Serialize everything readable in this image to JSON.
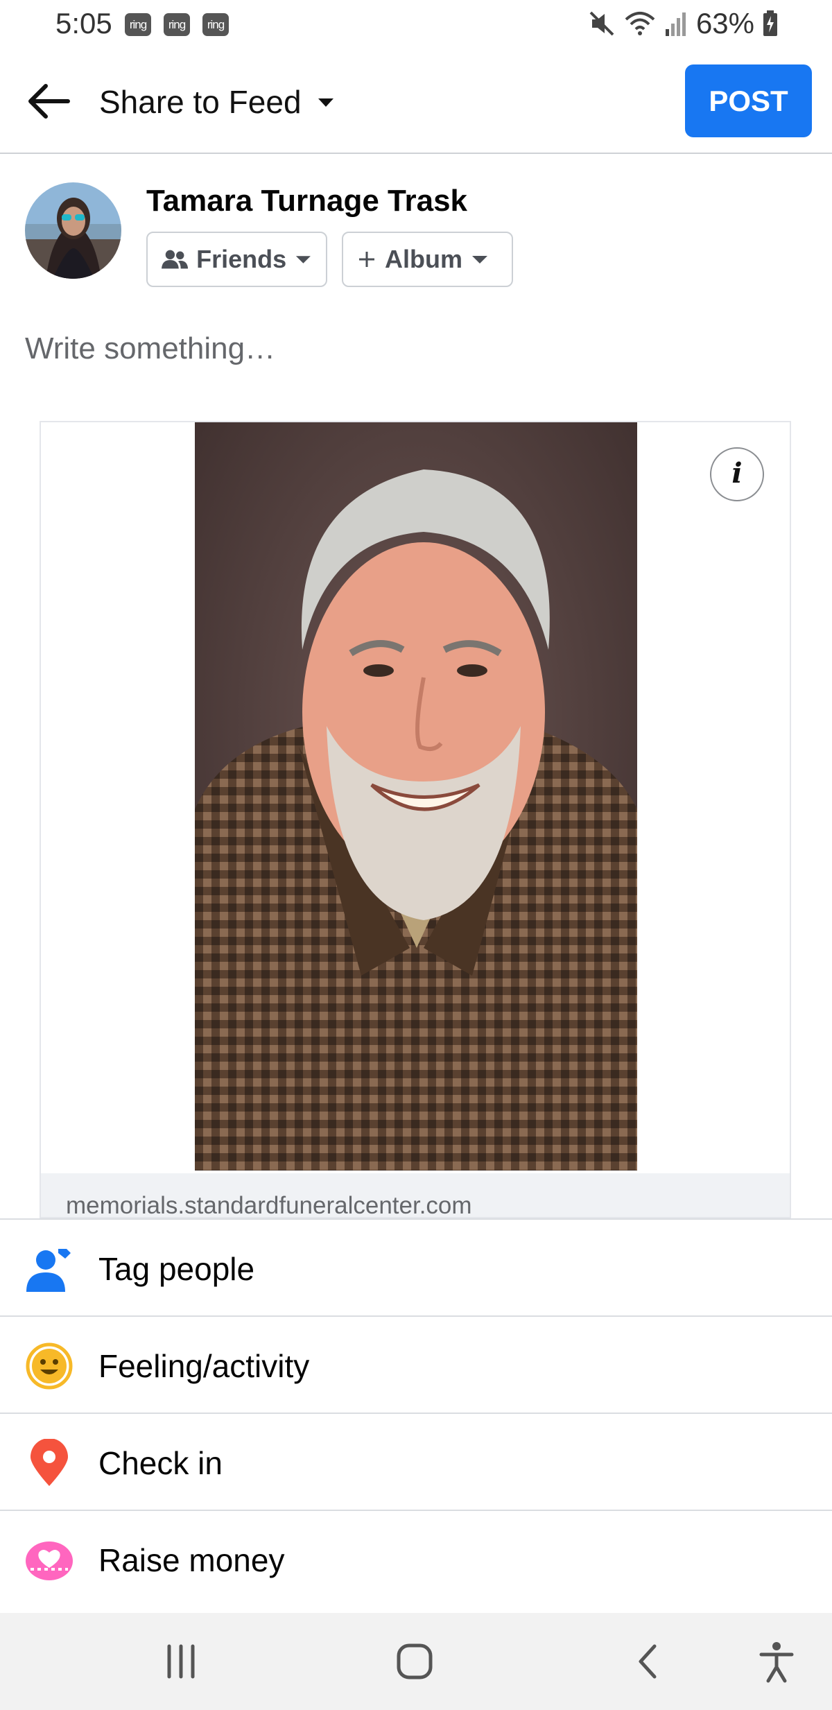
{
  "status_bar": {
    "time": "5:05",
    "notifications": [
      "ring",
      "ring",
      "ring"
    ],
    "battery": "63%",
    "icons": [
      "mute-icon",
      "wifi-icon",
      "signal-icon",
      "battery-charging-icon"
    ]
  },
  "header": {
    "back_icon": "arrow-left-icon",
    "title": "Share to Feed",
    "dropdown_icon": "caret-down-icon",
    "post_label": "POST"
  },
  "author": {
    "name": "Tamara Turnage Trask",
    "audience_label": "Friends",
    "album_label": "Album"
  },
  "composer": {
    "placeholder": "Write something…"
  },
  "link_card": {
    "domain": "memorials.standardfuneralcenter.com",
    "info_label": "i"
  },
  "actions": [
    {
      "label": "Tag people",
      "icon": "tag-people-icon",
      "color": "#1877f2"
    },
    {
      "label": "Feeling/activity",
      "icon": "smiley-icon",
      "color": "#f7b928"
    },
    {
      "label": "Check in",
      "icon": "location-pin-icon",
      "color": "#f5533d"
    },
    {
      "label": "Raise money",
      "icon": "fundraiser-icon",
      "color": "#ff66bf"
    }
  ],
  "nav_bar": {
    "icons": [
      "recent-apps-icon",
      "home-icon",
      "back-icon",
      "accessibility-icon"
    ]
  },
  "colors": {
    "accent": "#1877f2",
    "divider": "#dadde1"
  }
}
